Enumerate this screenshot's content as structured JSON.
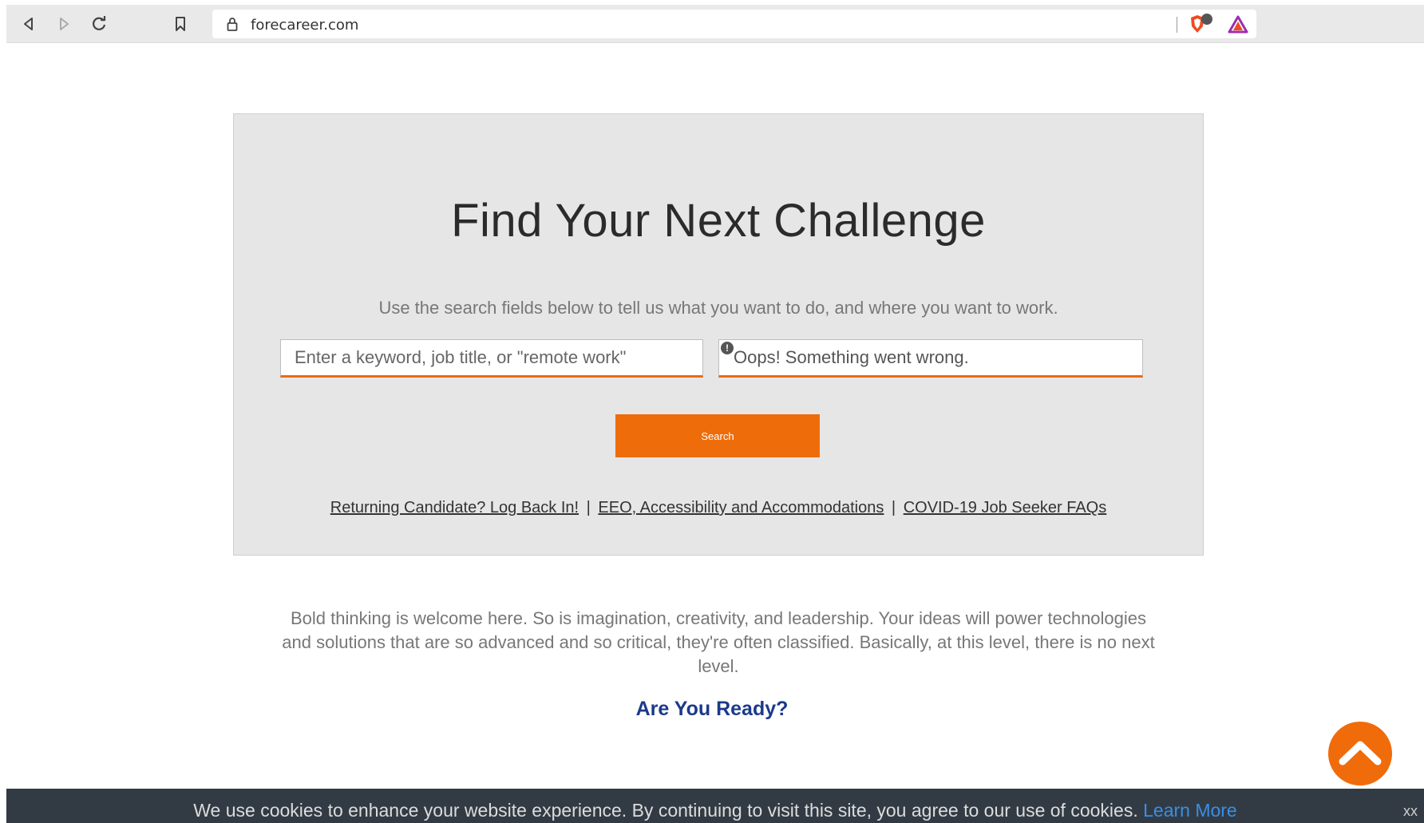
{
  "browser": {
    "url": "forecareer.com",
    "icons": [
      "back-icon",
      "forward-icon",
      "reload-icon",
      "bookmark-icon",
      "lock-icon",
      "brave-shield-icon",
      "brave-rewards-icon"
    ]
  },
  "panel": {
    "title": "Find Your Next Challenge",
    "subtitle": "Use the search fields below to tell us what you want to do, and where you want to work.",
    "keyword_placeholder": "Enter a keyword, job title, or \"remote work\"",
    "location_value": "Oops! Something went wrong.",
    "search_label": "Search",
    "links": [
      "Returning Candidate? Log Back In!",
      "EEO, Accessibility and Accommodations",
      "COVID-19 Job Seeker FAQs"
    ],
    "link_separator": "|"
  },
  "intro": {
    "text": "Bold thinking is welcome here. So is imagination, creativity, and leadership. Your ideas will power technologies and solutions that are so advanced and so critical, they're often classified. Basically, at this level, there is no next level.",
    "heading": "Are You Ready?"
  },
  "cookie": {
    "text": "We use cookies to enhance your website experience. By continuing to visit this site, you agree to our use of cookies.",
    "link": "Learn More",
    "close": "xx"
  },
  "colors": {
    "accent": "#ee6d0a",
    "heading_blue": "#1c3a8a",
    "banner_bg": "#323b44"
  }
}
